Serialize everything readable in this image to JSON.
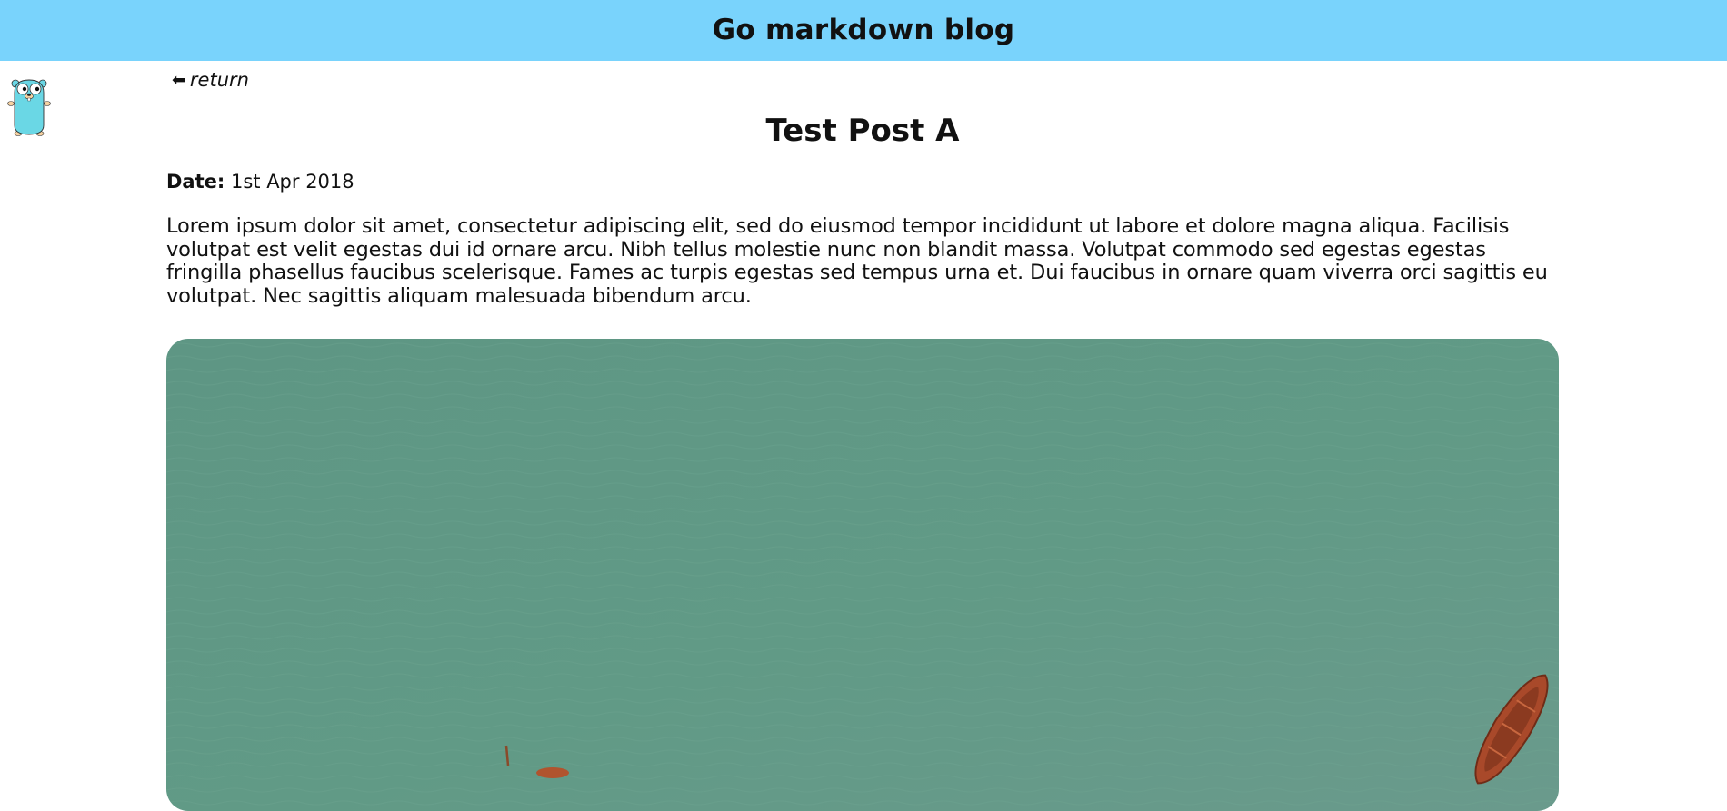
{
  "header": {
    "title": "Go markdown blog",
    "background_color": "#79d3fc"
  },
  "mascot": {
    "icon": "gopher-icon"
  },
  "nav": {
    "return_arrow": "⬅",
    "return_label": "return"
  },
  "post": {
    "title": "Test Post A",
    "date_label": "Date:",
    "date_value": "1st Apr 2018",
    "body": "Lorem ipsum dolor sit amet, consectetur adipiscing elit, sed do eiusmod tempor incididunt ut labore et dolore magna aliqua. Facilisis volutpat est velit egestas dui id ornare arcu. Nibh tellus molestie nunc non blandit massa. Volutpat commodo sed egestas egestas fringilla phasellus faucibus scelerisque. Fames ac turpis egestas sed tempus urna et. Dui faucibus in ornare quam viverra orci sagittis eu volutpat. Nec sagittis aliquam malesuada bibendum arcu.",
    "image": {
      "subject": "aerial view of turquoise water with wooden boats",
      "water_color": "#5f9681",
      "boat_color": "#a9492a"
    }
  }
}
